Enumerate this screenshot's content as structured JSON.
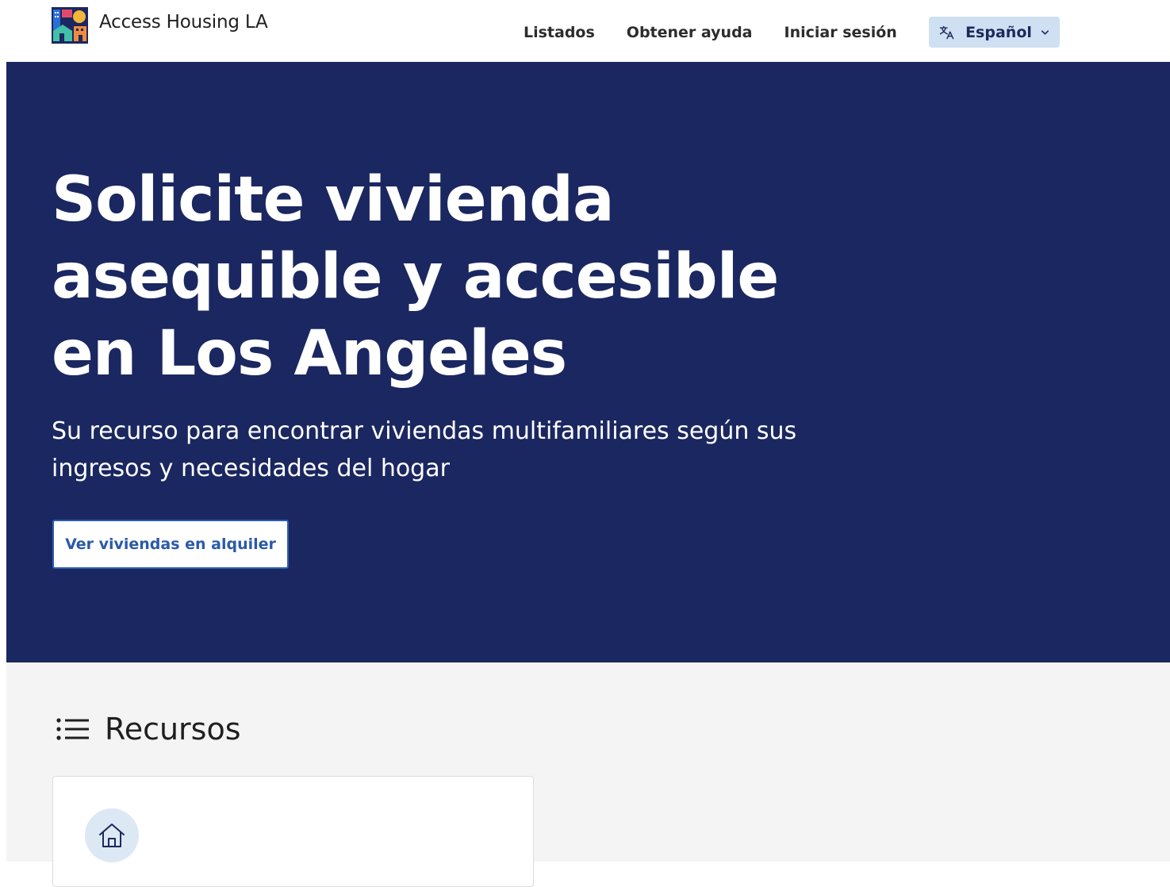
{
  "header": {
    "brand_name": "Access Housing LA",
    "nav": [
      {
        "label": "Listados"
      },
      {
        "label": "Obtener ayuda"
      },
      {
        "label": "Iniciar sesión"
      }
    ],
    "language": {
      "label": "Español",
      "icon": "translate-icon",
      "chevron": "chevron-down-icon"
    }
  },
  "hero": {
    "title": "Solicite vivienda asequible y accesible en Los Angeles",
    "subtitle": "Su recurso para encontrar viviendas multifamiliares según sus ingresos y necesidades del hogar",
    "cta_label": "Ver viviendas en alquiler"
  },
  "resources": {
    "heading": "Recursos",
    "heading_icon": "list-icon",
    "cards": [
      {
        "icon": "home-icon"
      }
    ]
  },
  "colors": {
    "hero_background": "#1b2760",
    "page_background_lower": "#f4f4f4",
    "language_button_background": "#cfe0f2",
    "cta_text": "#2a5aa8",
    "card_icon_background": "#dde8f5"
  }
}
